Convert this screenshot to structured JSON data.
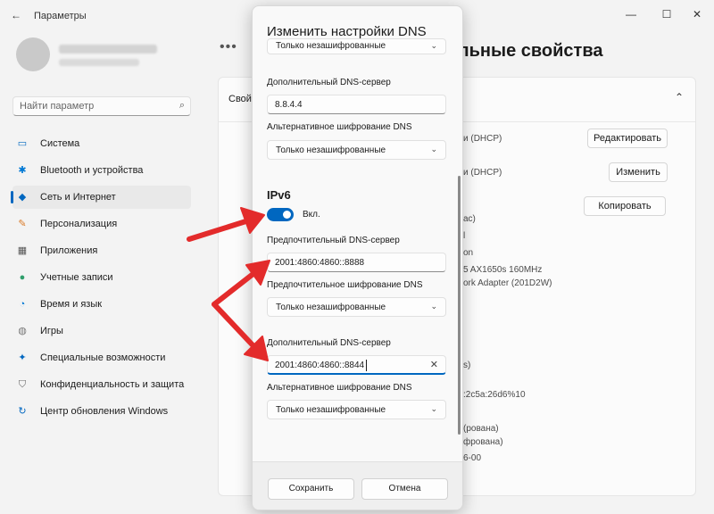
{
  "window": {
    "back_icon": "arrow-left-icon",
    "title": "Параметры",
    "minimize_icon": "minimize-icon",
    "maximize_icon": "maximize-icon",
    "close_icon": "close-icon"
  },
  "search": {
    "placeholder": "Найти параметр",
    "icon": "search-icon"
  },
  "sidebar": {
    "items": [
      {
        "label": "Система",
        "icon": "monitor-icon",
        "icon_color": "#0067c0",
        "active": false
      },
      {
        "label": "Bluetooth и устройства",
        "icon": "bluetooth-icon",
        "icon_color": "#0078d4",
        "active": false
      },
      {
        "label": "Сеть и Интернет",
        "icon": "wifi-icon",
        "icon_color": "#0067c0",
        "active": true
      },
      {
        "label": "Персонализация",
        "icon": "brush-icon",
        "icon_color": "#d97a27",
        "active": false
      },
      {
        "label": "Приложения",
        "icon": "apps-icon",
        "icon_color": "#555555",
        "active": false
      },
      {
        "label": "Учетные записи",
        "icon": "person-icon",
        "icon_color": "#2f9e6b",
        "active": false
      },
      {
        "label": "Время и язык",
        "icon": "globe-clock-icon",
        "icon_color": "#0078d4",
        "active": false
      },
      {
        "label": "Игры",
        "icon": "gamepad-icon",
        "icon_color": "#777777",
        "active": false
      },
      {
        "label": "Специальные возможности",
        "icon": "accessibility-icon",
        "icon_color": "#0067c0",
        "active": false
      },
      {
        "label": "Конфиденциальность и защита",
        "icon": "shield-icon",
        "icon_color": "#666666",
        "active": false
      },
      {
        "label": "Центр обновления Windows",
        "icon": "update-icon",
        "icon_color": "#0067c0",
        "active": false
      }
    ]
  },
  "main": {
    "heading": "тельные свойства",
    "dots": "•••",
    "card_title": "Свой",
    "chevron_icon": "chevron-up-icon",
    "edit_button_label": "Редактировать",
    "change_button_label": "Изменить",
    "copy_button_label": "Копировать",
    "partial_texts": [
      "и (DHCP)",
      "и (DHCP)",
      "ac)",
      "l",
      "on",
      "5 AX1650s 160MHz",
      "ork Adapter (201D2W)",
      "s)",
      ":2c5a:26d6%10",
      "(рована)",
      "фрована)",
      "6-00"
    ]
  },
  "dialog": {
    "title": "Изменить настройки DNS",
    "top_dropdown_value": "Только незашифрованные",
    "ipv4_alt_label": "Дополнительный DNS-сервер",
    "ipv4_alt_value": "8.8.4.4",
    "ipv4_alt_enc_label": "Альтернативное шифрование DNS",
    "ipv4_alt_enc_value": "Только незашифрованные",
    "ipv6_section": "IPv6",
    "ipv6_toggle_label": "Вкл.",
    "ipv6_toggle_on": true,
    "ipv6_pref_label": "Предпочтительный DNS-сервер",
    "ipv6_pref_value": "2001:4860:4860::8888",
    "ipv6_pref_enc_label": "Предпочтительное шифрование DNS",
    "ipv6_pref_enc_value": "Только незашифрованные",
    "ipv6_alt_label": "Дополнительный DNS-сервер",
    "ipv6_alt_value": "2001:4860:4860::8844",
    "ipv6_alt_enc_label": "Альтернативное шифрование DNS",
    "ipv6_alt_enc_value": "Только незашифрованные",
    "save_label": "Сохранить",
    "cancel_label": "Отмена",
    "accent_color": "#0067c0"
  },
  "annotations": {
    "arrow_color": "#e32b2b",
    "arrow_icon": "red-arrow-icon"
  }
}
